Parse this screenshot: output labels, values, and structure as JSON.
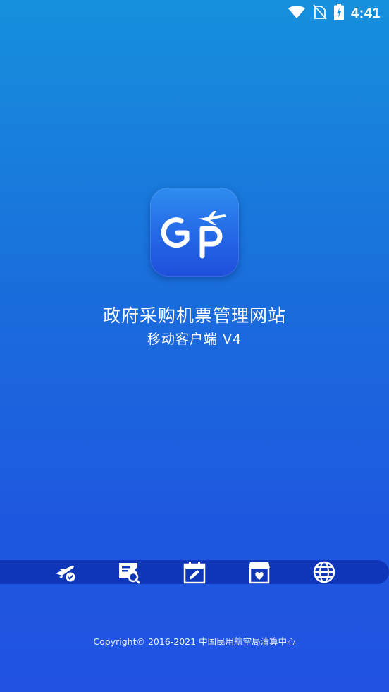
{
  "status_bar": {
    "time": "4:41",
    "icons": [
      "wifi-icon",
      "no-sim-icon",
      "battery-charging-icon"
    ]
  },
  "app": {
    "logo_text": "GP",
    "title": "政府采购机票管理网站",
    "subtitle": "移动客户端 V4"
  },
  "features": {
    "icons": [
      "plane-check-icon",
      "ticket-search-icon",
      "calendar-edit-icon",
      "store-heart-icon",
      "globe-icon"
    ]
  },
  "footer": {
    "copyright": "Copyright© 2016-2021 中国民用航空局清算中心"
  },
  "colors": {
    "background_top": "#1690dc",
    "background_bottom": "#2152e2",
    "strip": "#0f36b6",
    "logo": "#2467e6"
  }
}
